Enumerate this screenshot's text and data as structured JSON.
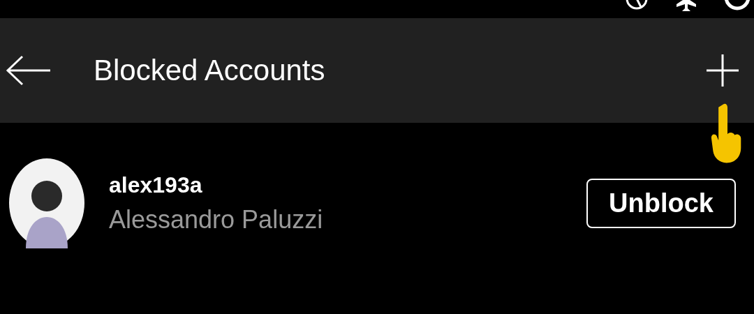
{
  "header": {
    "title": "Blocked Accounts"
  },
  "accounts": [
    {
      "username": "alex193a",
      "name": "Alessandro Paluzzi",
      "button": "Unblock"
    }
  ]
}
